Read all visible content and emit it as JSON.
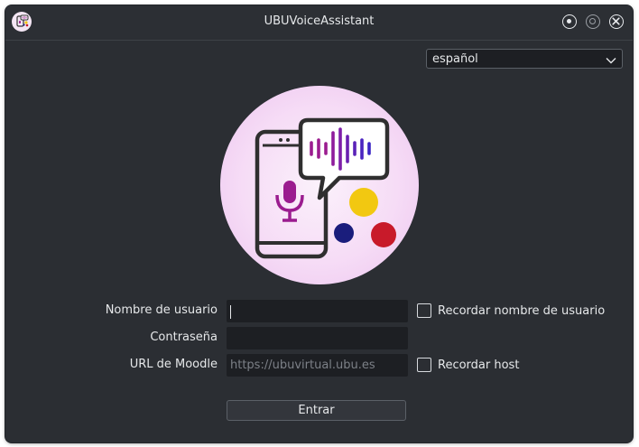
{
  "window": {
    "title": "UBUVoiceAssistant",
    "app_icon": "app-logo-icon",
    "controls": [
      "keep-above-icon",
      "minimize-icon",
      "close-icon"
    ]
  },
  "language": {
    "selected": "español",
    "icon": "chevron-down-icon"
  },
  "logo": {
    "icon": "voice-assistant-logo",
    "colors": {
      "purple": "#9b1c8f",
      "yellow": "#f2c811",
      "navy": "#1a1d7c",
      "red": "#c81a2a",
      "outline": "#2f2f2f"
    }
  },
  "form": {
    "username_label": "Nombre de usuario",
    "username_value": "",
    "password_label": "Contraseña",
    "password_value": "",
    "moodle_label": "URL de Moodle",
    "moodle_placeholder": "https://ubuvirtual.ubu.es",
    "remember_username_label": "Recordar nombre de usuario",
    "remember_username_checked": false,
    "remember_host_label": "Recordar host",
    "remember_host_checked": false,
    "submit_label": "Entrar"
  },
  "theme": {
    "background": "#2b2e33",
    "field_background": "#1d1f23",
    "text": "#e6e8ea",
    "placeholder": "#7c8087"
  }
}
